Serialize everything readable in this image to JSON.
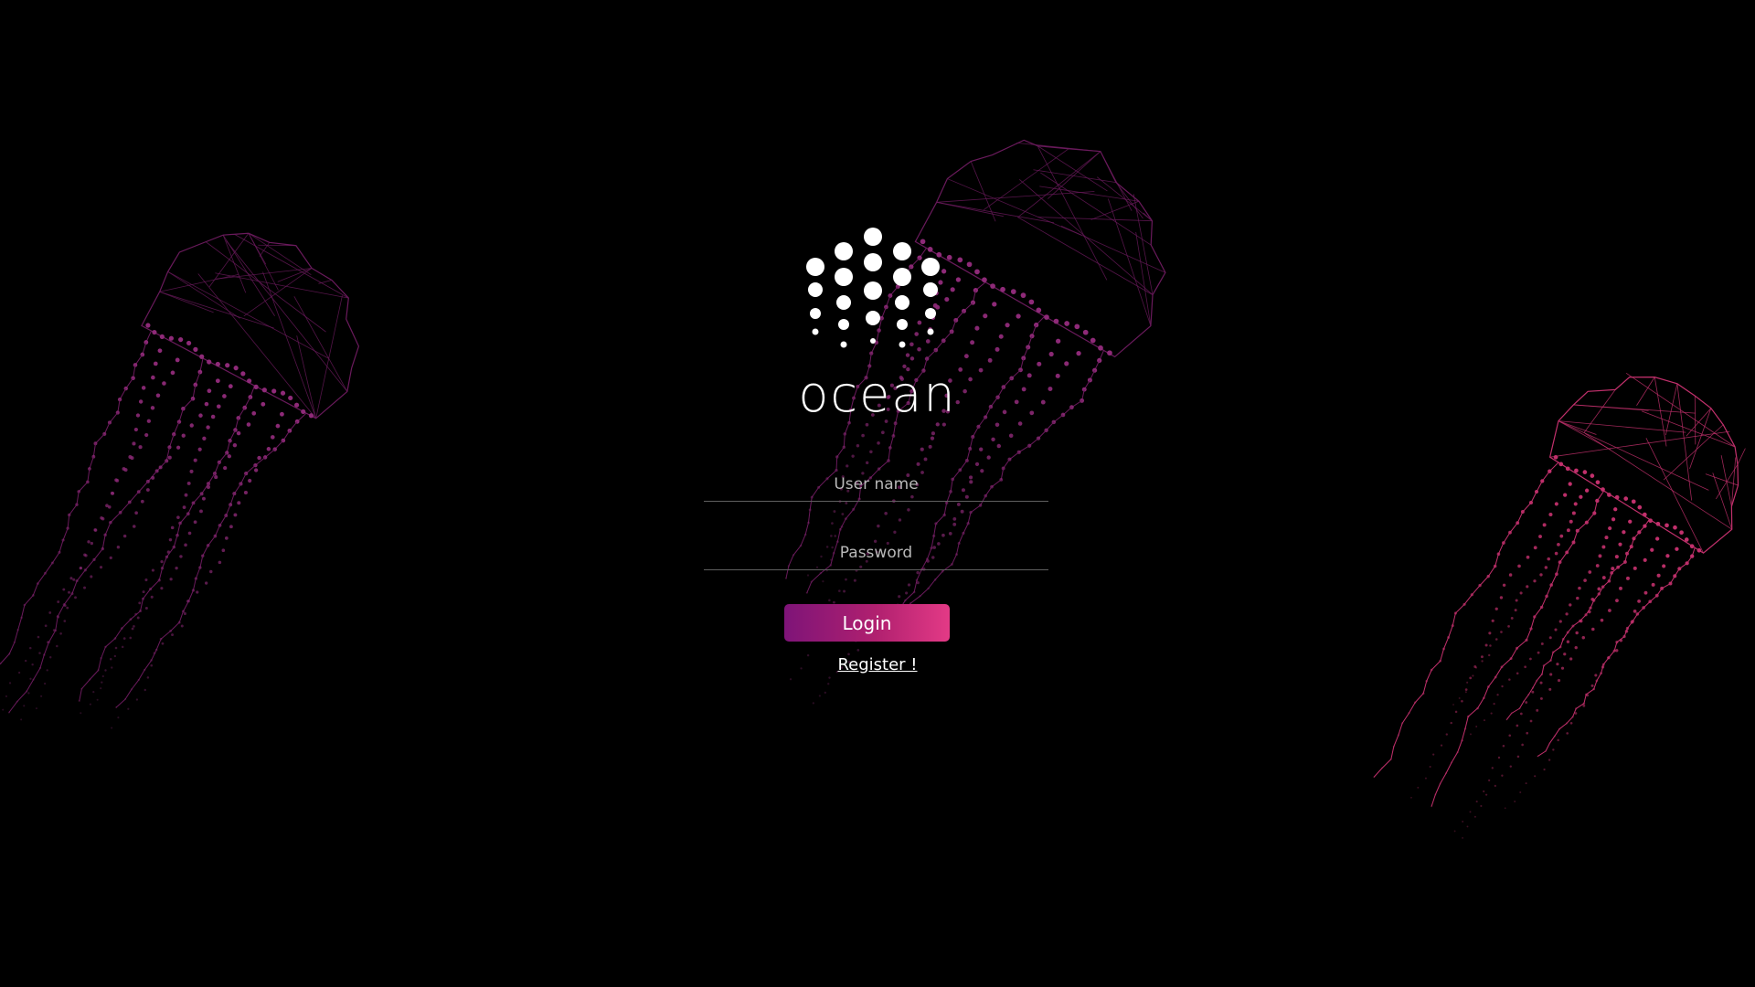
{
  "brand": {
    "name": "ocean"
  },
  "form": {
    "username_placeholder": "User name",
    "password_placeholder": "Password",
    "login_label": "Login",
    "register_label": "Register !"
  },
  "colors": {
    "background": "#000000",
    "accent_start": "#7e1478",
    "accent_end": "#e33a86",
    "jellyfish_line": "#6a1a5c",
    "jellyfish_dot": "#8e2a78",
    "jellyfish_right": "#c2306c"
  },
  "icons": {
    "logo": "ocean-dot-grid-logo"
  }
}
